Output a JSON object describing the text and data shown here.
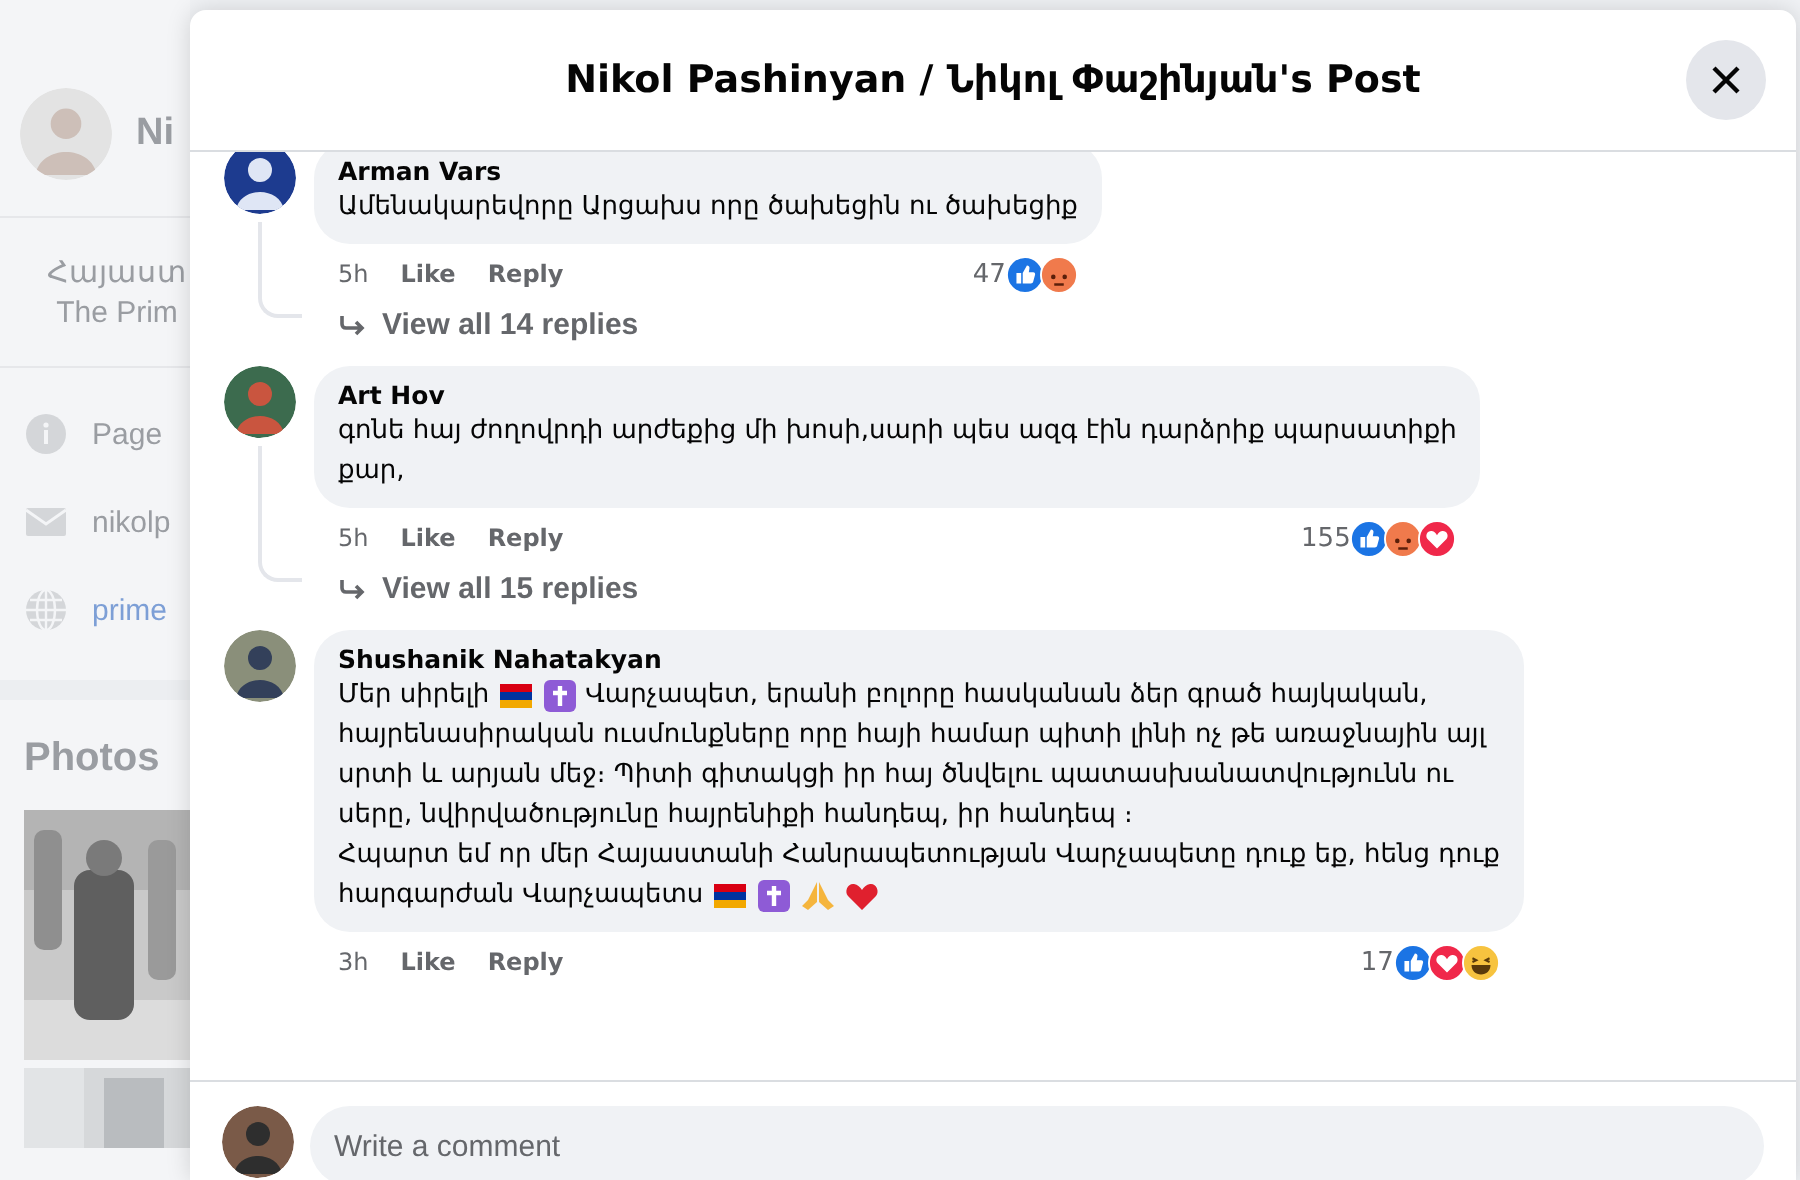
{
  "background_page": {
    "profile_name": "Ni",
    "intro_lines": [
      "Հայաստ",
      "The Prim"
    ],
    "info_items": [
      {
        "kind": "info",
        "text": "Page"
      },
      {
        "kind": "mail",
        "text": "nikolp"
      },
      {
        "kind": "web",
        "text": "prime"
      }
    ],
    "photos_title": "Photos"
  },
  "dialog": {
    "title": "Nikol Pashinyan / Նիկոլ Փաշինյան's Post"
  },
  "comments": [
    {
      "author": "Arman Vars",
      "lines": [
        [
          {
            "kind": "text",
            "text": "Ամենակարեվորը Արցախս որը ծախեցին ու ծախեցիք"
          }
        ]
      ],
      "time": "5h",
      "like": "Like",
      "reply": "Reply",
      "count": "47",
      "reactions": [
        {
          "kind": "like"
        },
        {
          "kind": "angry"
        }
      ],
      "replies": "View all 14 replies"
    },
    {
      "author": "Art Hov",
      "lines": [
        [
          {
            "kind": "text",
            "text": "գոնե հայ ժողովրդի արժեքից մի խոսի,սարի պես ազգ էին դարձրիք պարսատիքի"
          }
        ],
        [
          {
            "kind": "text",
            "text": "քար,"
          }
        ]
      ],
      "time": "5h",
      "like": "Like",
      "reply": "Reply",
      "count": "155",
      "reactions": [
        {
          "kind": "like"
        },
        {
          "kind": "angry"
        },
        {
          "kind": "love"
        }
      ],
      "replies": "View all 15 replies"
    },
    {
      "author": "Shushanik Nahatakyan",
      "lines": [
        [
          {
            "kind": "text",
            "text": "Մեր սիրելի"
          },
          {
            "kind": "flag"
          },
          {
            "kind": "cross"
          },
          {
            "kind": "text",
            "text": "Վարչապետ, երանի բոլորը հասկանան ձեր գրած հայկական,"
          }
        ],
        [
          {
            "kind": "text",
            "text": "հայրենասիրական ուսմունքները որը հայի համար պիտի լինի ոչ թե առաջնային այլ"
          }
        ],
        [
          {
            "kind": "text",
            "text": "սրտի և արյան մեջ։ Պիտի գիտակցի իր հայ ծնվելու պատասխանատվությունն ու"
          }
        ],
        [
          {
            "kind": "text",
            "text": "սերը, նվիրվածությունը հայրենիքի հանդեպ, իր հանդեպ ։"
          }
        ],
        [
          {
            "kind": "text",
            "text": "Հպարտ եմ որ մեր Հայաստանի Հանրապետության Վարչապետը դուք եք, հենց դուք"
          }
        ],
        [
          {
            "kind": "text",
            "text": "հարգարժան Վարչապետս"
          },
          {
            "kind": "flag"
          },
          {
            "kind": "cross"
          },
          {
            "kind": "pray"
          },
          {
            "kind": "heart"
          }
        ]
      ],
      "time": "3h",
      "like": "Like",
      "reply": "Reply",
      "count": "17",
      "reactions": [
        {
          "kind": "like"
        },
        {
          "kind": "love"
        },
        {
          "kind": "haha"
        }
      ]
    }
  ],
  "composer": {
    "placeholder": "Write a comment"
  }
}
